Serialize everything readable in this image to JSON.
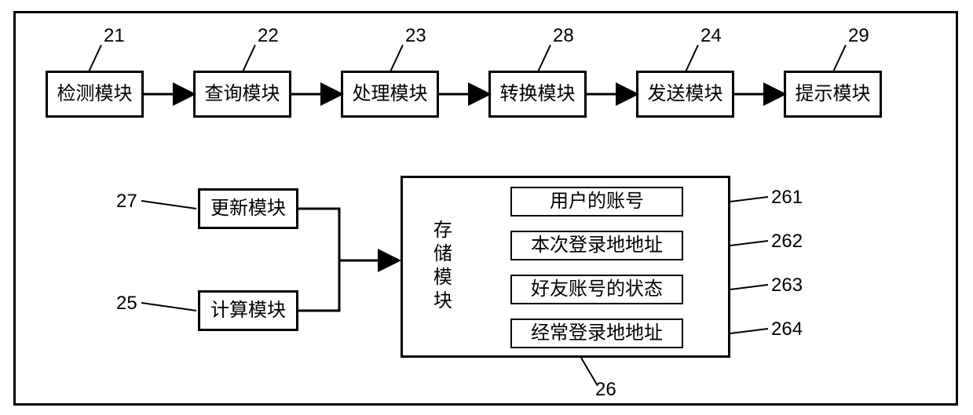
{
  "top_row": {
    "b21": {
      "num": "21",
      "text": "检测模块"
    },
    "b22": {
      "num": "22",
      "text": "查询模块"
    },
    "b23": {
      "num": "23",
      "text": "处理模块"
    },
    "b28": {
      "num": "28",
      "text": "转换模块"
    },
    "b24": {
      "num": "24",
      "text": "发送模块"
    },
    "b29": {
      "num": "29",
      "text": "提示模块"
    }
  },
  "left_col": {
    "b27": {
      "num": "27",
      "text": "更新模块"
    },
    "b25": {
      "num": "25",
      "text": "计算模块"
    }
  },
  "storage": {
    "num": "26",
    "title": "存储模块",
    "items": {
      "i261": {
        "num": "261",
        "text": "用户的账号"
      },
      "i262": {
        "num": "262",
        "text": "本次登录地地址"
      },
      "i263": {
        "num": "263",
        "text": "好友账号的状态"
      },
      "i264": {
        "num": "264",
        "text": "经常登录地地址"
      }
    }
  }
}
